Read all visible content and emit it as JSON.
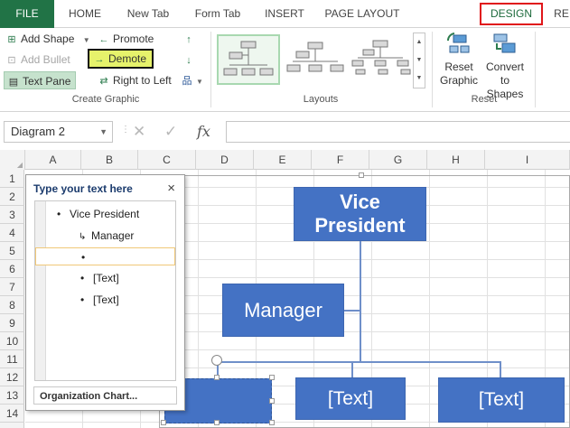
{
  "ribbon_tabs": [
    {
      "label": "FILE"
    },
    {
      "label": "HOME"
    },
    {
      "label": "New Tab"
    },
    {
      "label": "Form Tab"
    },
    {
      "label": "INSERT"
    },
    {
      "label": "PAGE LAYOUT"
    },
    {
      "label": "DESIGN"
    },
    {
      "label": "RE"
    }
  ],
  "create_graphic": {
    "label": "Create Graphic",
    "add_shape": "Add Shape",
    "add_bullet": "Add Bullet",
    "text_pane": "Text Pane",
    "promote": "Promote",
    "demote": "Demote",
    "right_to_left": "Right to Left"
  },
  "layouts": {
    "label": "Layouts"
  },
  "reset": {
    "label": "Reset",
    "reset_graphic_line1": "Reset",
    "reset_graphic_line2": "Graphic",
    "convert_line1": "Convert",
    "convert_line2": "to Shapes"
  },
  "formula_bar": {
    "name_box": "Diagram 2",
    "cancel": "✕",
    "enter": "✓",
    "fx": "fx"
  },
  "columns": [
    "A",
    "B",
    "C",
    "D",
    "E",
    "F",
    "G",
    "H",
    "I"
  ],
  "rows": [
    "1",
    "2",
    "3",
    "4",
    "5",
    "6",
    "7",
    "8",
    "9",
    "10",
    "11",
    "12",
    "13",
    "14"
  ],
  "text_pane": {
    "title": "Type your text here",
    "close": "×",
    "items": [
      {
        "text": "Vice President",
        "bullet": "•"
      },
      {
        "text": "Manager",
        "bullet": "↳"
      },
      {
        "text": "",
        "bullet": "•"
      },
      {
        "text": "[Text]",
        "bullet": "•"
      },
      {
        "text": "[Text]",
        "bullet": "•"
      }
    ],
    "footer": "Organization Chart..."
  },
  "org_chart": {
    "top": "Vice President",
    "assistant": "Manager",
    "child_1": "",
    "child_2": "[Text]",
    "child_3": "[Text]"
  },
  "colors": {
    "accent": "#217346",
    "shape_fill": "#4472c4",
    "highlight": "#e6f26b",
    "design_outline": "#e0161a"
  }
}
